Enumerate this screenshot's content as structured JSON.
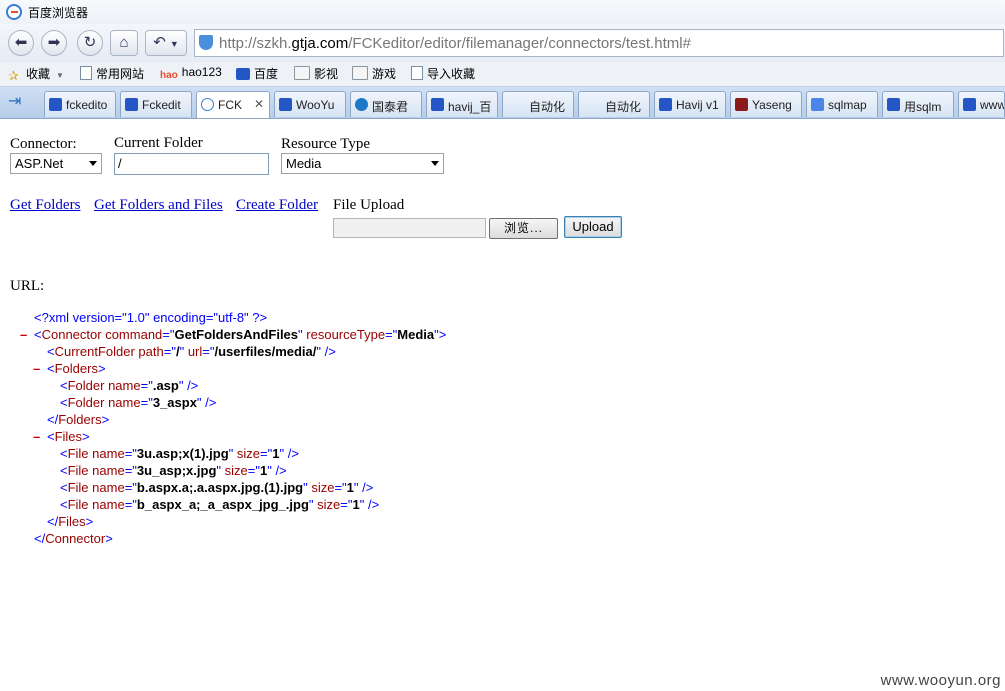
{
  "window": {
    "title": "百度浏览器"
  },
  "address": {
    "prefix": "http://szkh.",
    "domain": "gtja.com",
    "path": "/FCKeditor/editor/filemanager/connectors/test.html#"
  },
  "bookmarks": [
    {
      "label": "收藏",
      "icon": "star-icon"
    },
    {
      "label": "常用网站",
      "icon": "page-icon"
    },
    {
      "label": "hao123",
      "icon": "hao-icon"
    },
    {
      "label": "百度",
      "icon": "paw-icon"
    },
    {
      "label": "影视",
      "icon": "folder-icon"
    },
    {
      "label": "游戏",
      "icon": "folder-icon"
    },
    {
      "label": "导入收藏",
      "icon": "import-icon"
    }
  ],
  "tabs": [
    {
      "label": "fckedito"
    },
    {
      "label": "Fckedit"
    },
    {
      "label": "FCK"
    },
    {
      "label": "WooYu"
    },
    {
      "label": "国泰君"
    },
    {
      "label": "havij_百"
    },
    {
      "label": "自动化"
    },
    {
      "label": "自动化"
    },
    {
      "label": "Havij v1"
    },
    {
      "label": "Yaseng"
    },
    {
      "label": "sqlmap"
    },
    {
      "label": "用sqlm"
    },
    {
      "label": "www"
    }
  ],
  "form": {
    "connector_label": "Connector:",
    "connector_value": "ASP.Net",
    "folder_label": "Current Folder",
    "folder_value": "/",
    "resource_label": "Resource Type",
    "resource_value": "Media",
    "link_get_folders": "Get Folders",
    "link_get_folders_files": "Get Folders and Files",
    "link_create_folder": "Create Folder",
    "upload_label": "File Upload",
    "browse_label": "浏览...",
    "upload_button": "Upload",
    "url_label": "URL:"
  },
  "xml": {
    "decl": "<?xml version=\"1.0\" encoding=\"utf-8\" ?>",
    "command": "GetFoldersAndFiles",
    "resource_type": "Media",
    "current_path": "/",
    "current_url": "/userfiles/media/",
    "folders": [
      ".asp",
      "3_aspx"
    ],
    "files": [
      {
        "name": "3u.asp;x(1).jpg",
        "size": "1"
      },
      {
        "name": "3u_asp;x.jpg",
        "size": "1"
      },
      {
        "name": "b.aspx.a;.a.aspx.jpg.(1).jpg",
        "size": "1"
      },
      {
        "name": "b_aspx_a;_a_aspx_jpg_.jpg",
        "size": "1"
      }
    ]
  },
  "watermark": "www.wooyun.org"
}
